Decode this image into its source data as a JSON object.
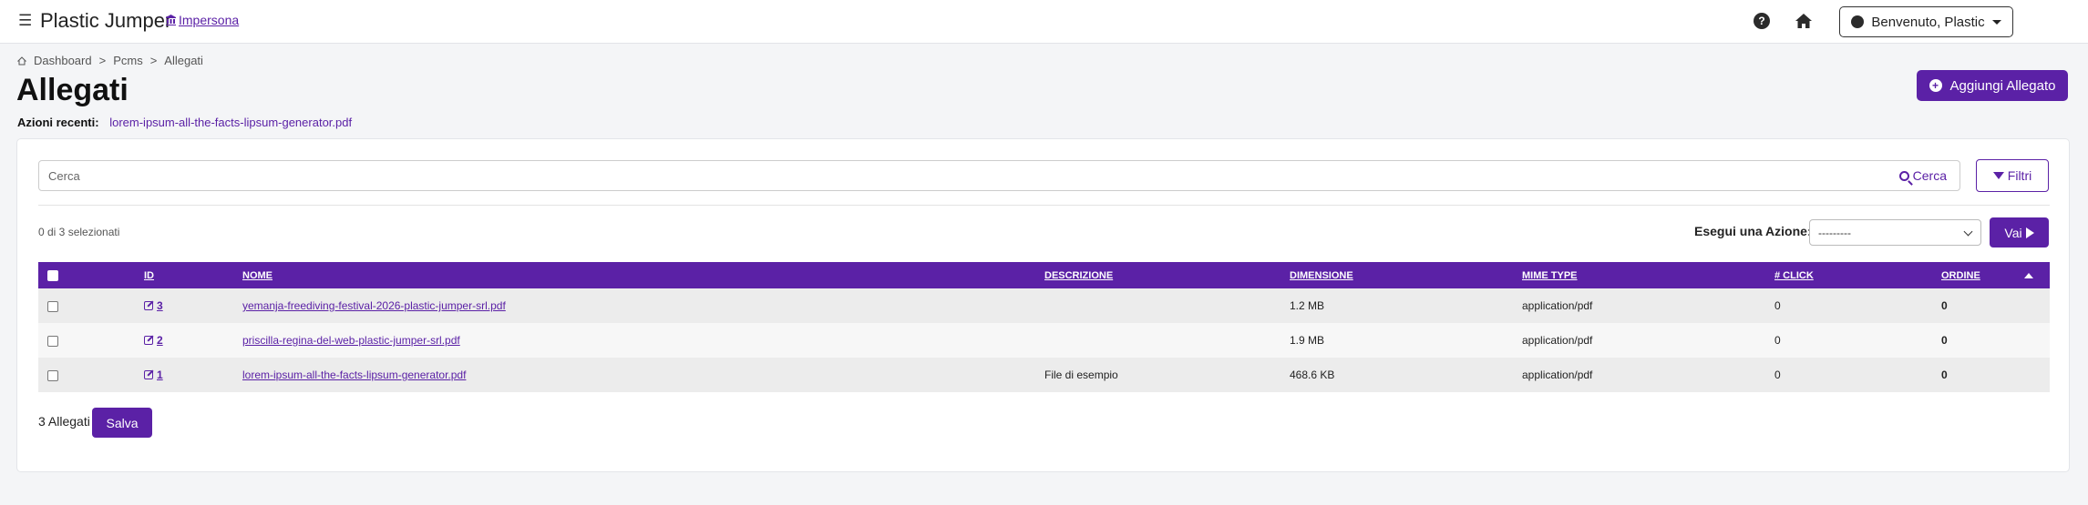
{
  "app": {
    "title": "Plastic Jumper",
    "impersona": "Impersona",
    "user_menu": "Benvenuto, Plastic"
  },
  "breadcrumb": [
    "Dashboard",
    "Pcms",
    "Allegati"
  ],
  "breadcrumb_separator": ">",
  "page": {
    "title": "Allegati",
    "add_button": "Aggiungi Allegato",
    "recent_label": "Azioni recenti",
    "recent_link": "lorem-ipsum-all-the-facts-lipsum-generator.pdf"
  },
  "search": {
    "placeholder": "Cerca",
    "button": "Cerca",
    "filter_button": "Filtri"
  },
  "actions": {
    "selected_count": "0 di 3 selezionati",
    "label": "Esegui una Azione:",
    "select_value": "---------",
    "go_button": "Vai"
  },
  "table": {
    "columns": [
      "ID",
      "NOME",
      "DESCRIZIONE",
      "DIMENSIONE",
      "MIME TYPE",
      "# CLICK",
      "ORDINE"
    ],
    "rows": [
      {
        "id": "3",
        "nome": "yemanja-freediving-festival-2026-plastic-jumper-srl.pdf",
        "descrizione": "",
        "dimensione": "1.2 MB",
        "mime": "application/pdf",
        "click": "0",
        "ordine": "0"
      },
      {
        "id": "2",
        "nome": "priscilla-regina-del-web-plastic-jumper-srl.pdf",
        "descrizione": "",
        "dimensione": "1.9 MB",
        "mime": "application/pdf",
        "click": "0",
        "ordine": "0"
      },
      {
        "id": "1",
        "nome": "lorem-ipsum-all-the-facts-lipsum-generator.pdf",
        "descrizione": "File di esempio",
        "dimensione": "468.6 KB",
        "mime": "application/pdf",
        "click": "0",
        "ordine": "0"
      }
    ]
  },
  "footer": {
    "count": "3 Allegati",
    "save_button": "Salva"
  },
  "icons": [
    "hamburger-icon",
    "building-icon",
    "help-icon",
    "home-icon",
    "user-circle-icon",
    "plus-circle-icon",
    "search-icon",
    "filter-icon",
    "chevron-down-icon",
    "play-icon",
    "edit-icon",
    "sort-up-icon"
  ],
  "colors": {
    "accent": "#5b21a6",
    "background": "#f4f5f7"
  }
}
